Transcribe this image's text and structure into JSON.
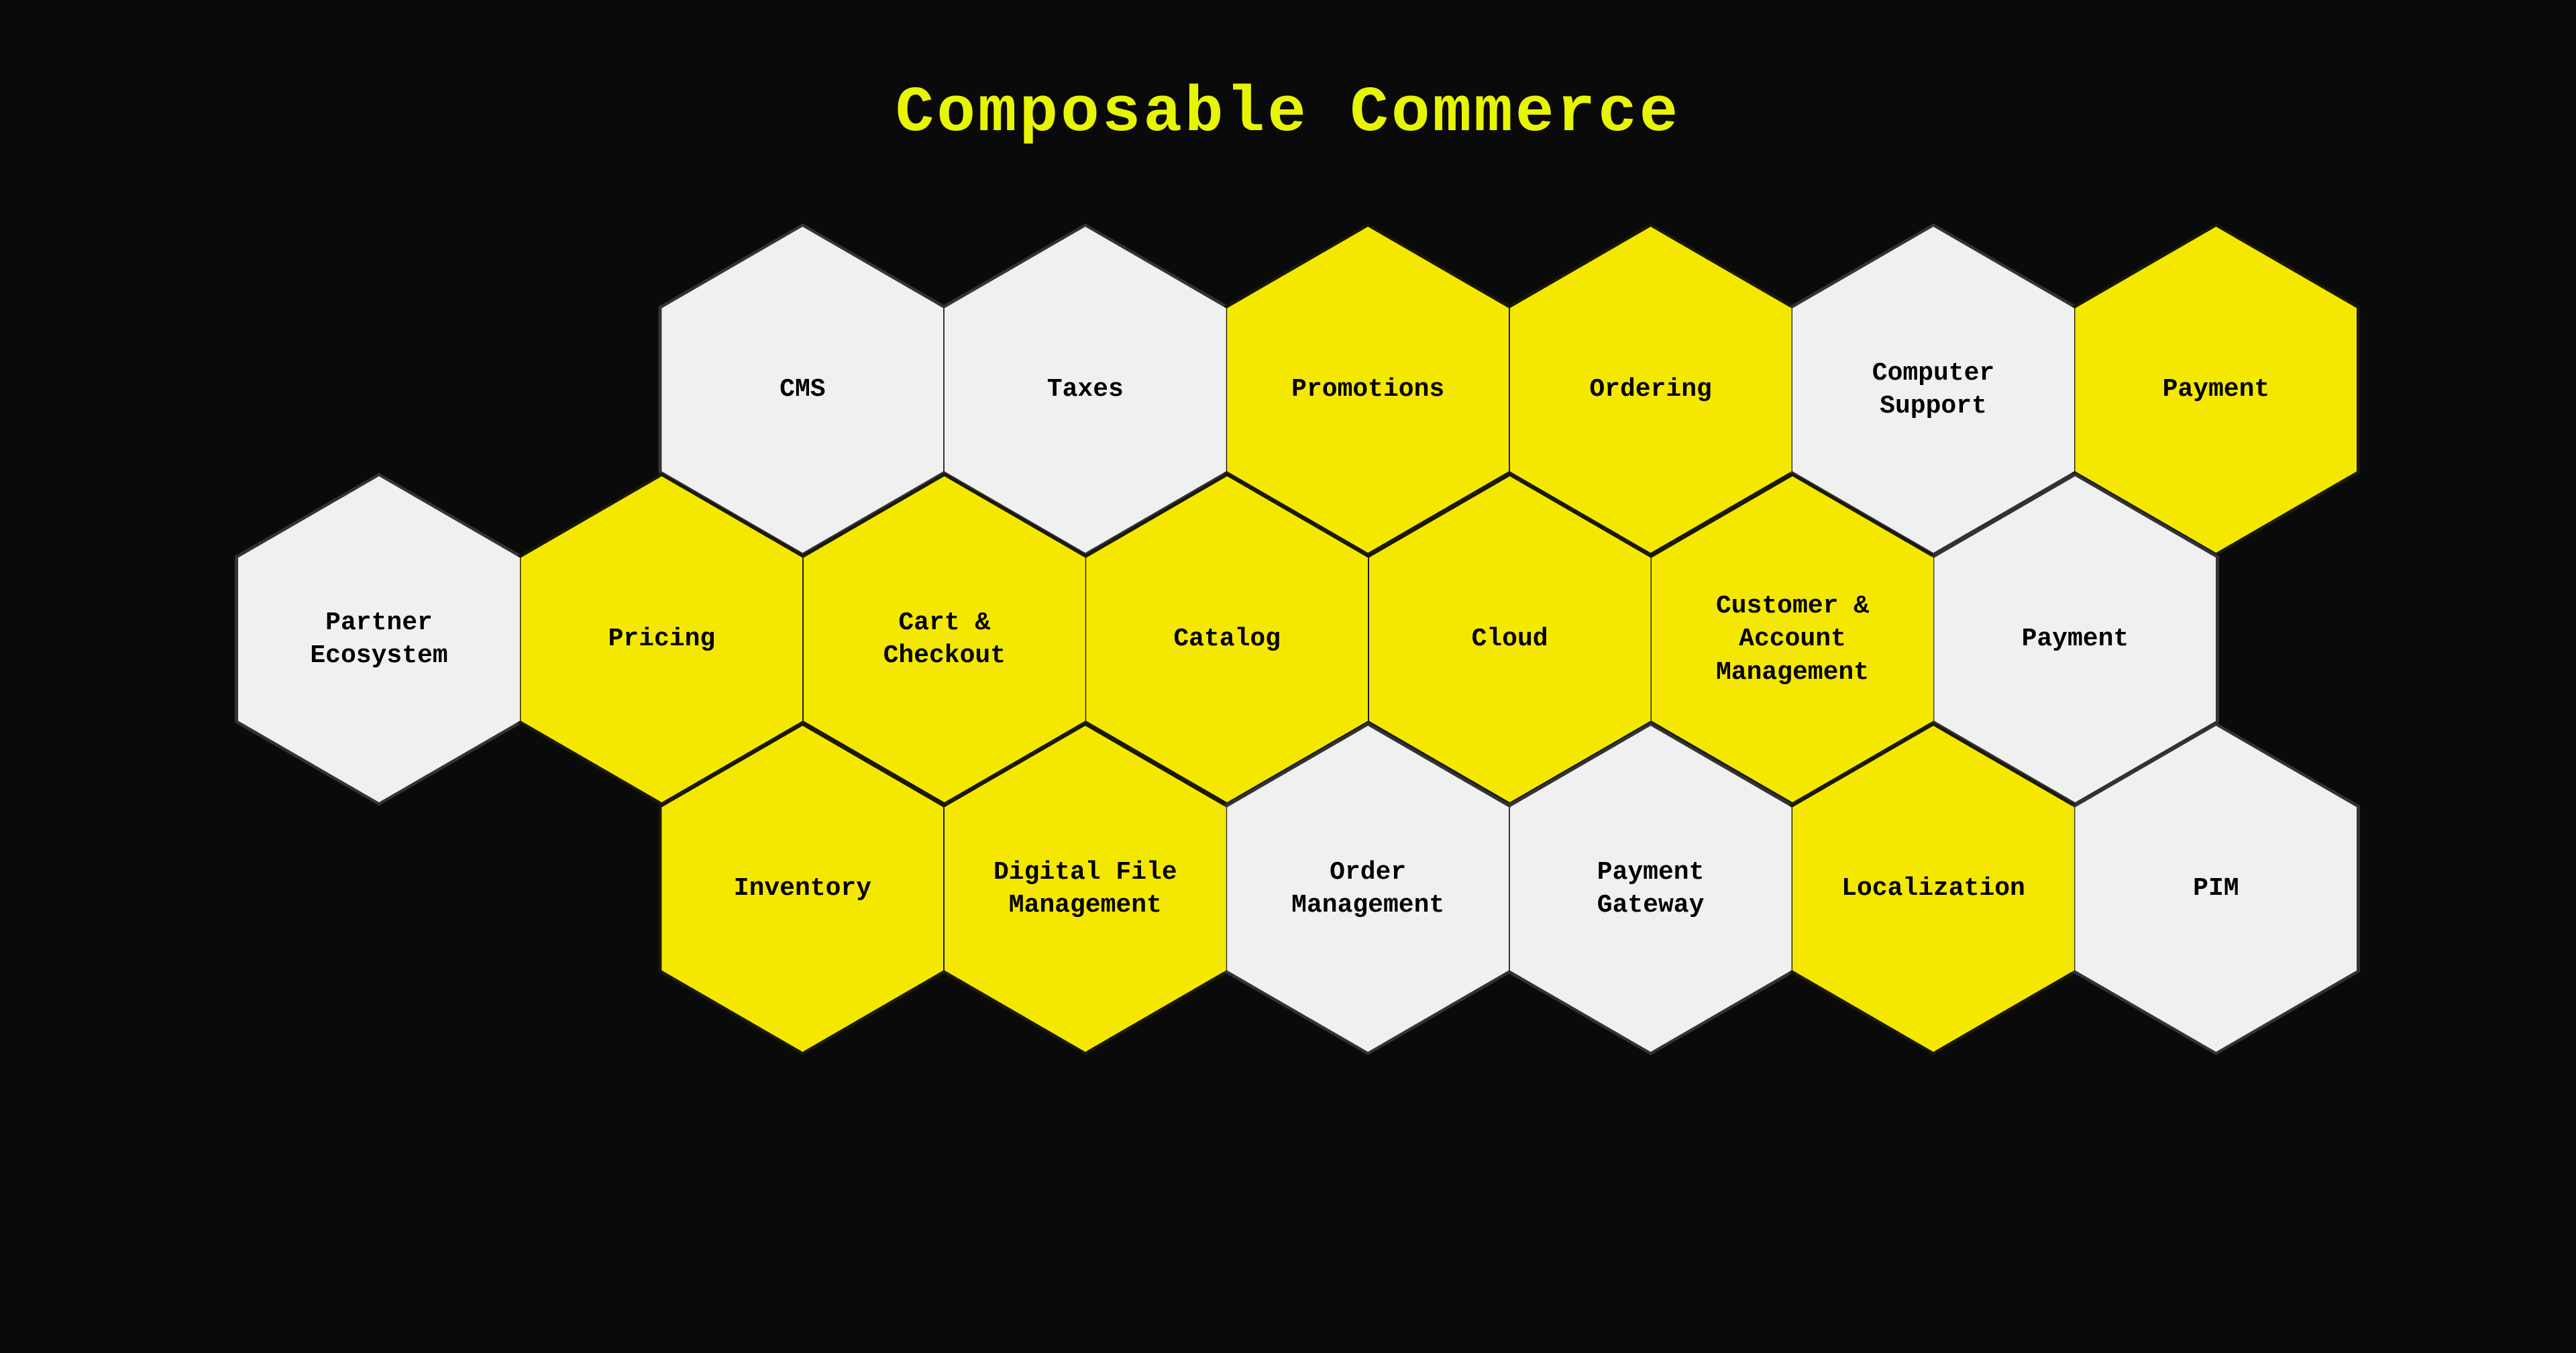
{
  "title": "Composable Commerce",
  "colors": {
    "background": "#0a0a0a",
    "yellow": "#f5e800",
    "white": "#f0f0f0",
    "text_yellow": "#000000",
    "text_white": "#000000",
    "title": "#e8f500",
    "border_dark": "#1a1a00",
    "border_light": "#333333"
  },
  "hexagons": [
    {
      "id": "cms",
      "label": "CMS",
      "color": "white",
      "row": 0,
      "col": 1
    },
    {
      "id": "taxes",
      "label": "Taxes",
      "color": "white",
      "row": 0,
      "col": 2
    },
    {
      "id": "promotions",
      "label": "Promotions",
      "color": "yellow",
      "row": 0,
      "col": 3
    },
    {
      "id": "ordering",
      "label": "Ordering",
      "color": "yellow",
      "row": 0,
      "col": 4
    },
    {
      "id": "computer-support",
      "label": "Computer\nSupport",
      "color": "white",
      "row": 0,
      "col": 5
    },
    {
      "id": "payment-top",
      "label": "Payment",
      "color": "yellow",
      "row": 0,
      "col": 6
    },
    {
      "id": "partner-ecosystem",
      "label": "Partner\nEcosystem",
      "color": "white",
      "row": 1,
      "col": 0
    },
    {
      "id": "pricing",
      "label": "Pricing",
      "color": "yellow",
      "row": 1,
      "col": 1
    },
    {
      "id": "cart-checkout",
      "label": "Cart &\nCheckout",
      "color": "yellow",
      "row": 1,
      "col": 2
    },
    {
      "id": "catalog",
      "label": "Catalog",
      "color": "yellow",
      "row": 1,
      "col": 3
    },
    {
      "id": "cloud",
      "label": "Cloud",
      "color": "yellow",
      "row": 1,
      "col": 4
    },
    {
      "id": "customer-account",
      "label": "Customer &\nAccount\nManagement",
      "color": "yellow",
      "row": 1,
      "col": 5
    },
    {
      "id": "payment-right",
      "label": "Payment",
      "color": "white",
      "row": 1,
      "col": 6
    },
    {
      "id": "inventory",
      "label": "Inventory",
      "color": "yellow",
      "row": 2,
      "col": 1
    },
    {
      "id": "digital-file",
      "label": "Digital File\nManagement",
      "color": "yellow",
      "row": 2,
      "col": 2
    },
    {
      "id": "order-management",
      "label": "Order\nManagement",
      "color": "white",
      "row": 2,
      "col": 3
    },
    {
      "id": "payment-gateway",
      "label": "Payment\nGateway",
      "color": "white",
      "row": 2,
      "col": 4
    },
    {
      "id": "localization",
      "label": "Localization",
      "color": "yellow",
      "row": 2,
      "col": 5
    },
    {
      "id": "pim",
      "label": "PIM",
      "color": "white",
      "row": 2,
      "col": 6
    }
  ]
}
